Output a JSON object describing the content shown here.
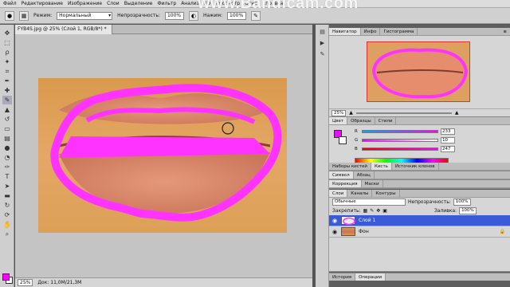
{
  "watermark": "www.Bandicam.com",
  "menu": [
    "Файл",
    "Редактирование",
    "Изображение",
    "Слои",
    "Выделение",
    "Фильтр",
    "Анализ",
    "3D",
    "Просмотр",
    "Окно",
    "Справка"
  ],
  "options": {
    "mode_label": "Режим:",
    "mode_value": "Нормальный",
    "opacity_label": "Непрозрачность:",
    "opacity_value": "100%",
    "pressure_label": "Нажим:",
    "pressure_value": "100%"
  },
  "document": {
    "tab_title": "FYB4S.jpg @ 25% (Слой 1, RGB/8*) *",
    "zoom": "25%",
    "doc_info": "Док: 11,0М/21,3М"
  },
  "navigator": {
    "tabs": [
      "Навигатор",
      "Инфо",
      "Гистограмма"
    ],
    "zoom": "25%"
  },
  "color_panel": {
    "tabs": [
      "Цвет",
      "Образцы",
      "Стили"
    ],
    "channels": [
      {
        "name": "R",
        "value": "233"
      },
      {
        "name": "G",
        "value": "10"
      },
      {
        "name": "B",
        "value": "247"
      }
    ],
    "foreground": "#e90af7"
  },
  "adjust_panel": {
    "tabs_1": [
      "Наборы кистей",
      "Кисть",
      "Источник клонов"
    ],
    "tabs_2": [
      "Символ",
      "Абзац"
    ],
    "tabs_3": [
      "Коррекция",
      "Маски"
    ]
  },
  "layers_panel": {
    "tabs": [
      "Слои",
      "Каналы",
      "Контуры"
    ],
    "blend_mode": "Обычные",
    "opacity_label": "Непрозрачность:",
    "opacity_value": "100%",
    "lock_label": "Закрепить:",
    "fill_label": "Заливка:",
    "fill_value": "100%",
    "layers": [
      {
        "name": "Слой 1",
        "selected": true
      },
      {
        "name": "Фон",
        "selected": false
      }
    ]
  },
  "bottom_tabs": [
    "История",
    "Операции"
  ],
  "colors": {
    "stroke": "#ff33ff",
    "selected_layer": "#3a5ad8"
  }
}
